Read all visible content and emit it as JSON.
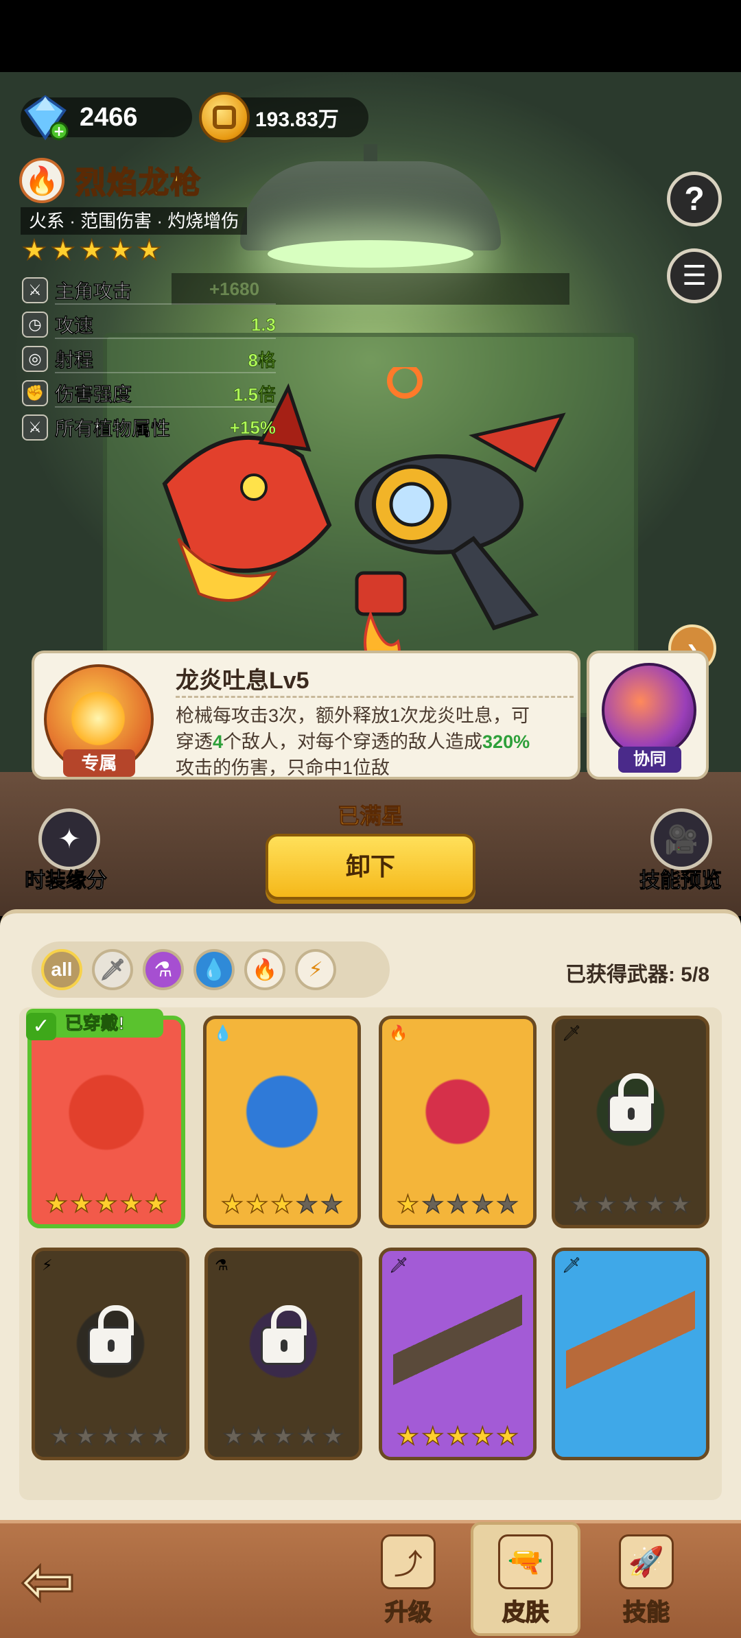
{
  "currency": {
    "gems": "2466",
    "gold": "193.83万"
  },
  "weapon": {
    "name": "烈焰龙枪",
    "tags": "火系 · 范围伤害 · 灼烧增伤",
    "stars": 5,
    "stats": [
      {
        "label": "主角攻击",
        "value": "+1680"
      },
      {
        "label": "攻速",
        "value": "1.3"
      },
      {
        "label": "射程",
        "value": "8格"
      },
      {
        "label": "伤害强度",
        "value": "1.5倍"
      },
      {
        "label": "所有植物属性",
        "value": "+15%"
      }
    ]
  },
  "skill": {
    "title": "龙炎吐息Lv5",
    "desc_parts": [
      "枪械每攻击3次，额外释放1次龙炎吐息，可穿透",
      "4",
      "个敌人，对每个穿透的敌人造成",
      "320%",
      "攻击的伤害，只命中1位敌"
    ],
    "exclusive_tag": "专属",
    "synergy_tag": "协同"
  },
  "status_text": "已满星",
  "unequip_label": "卸下",
  "side": {
    "costume": "时装缘分",
    "preview": "技能预览"
  },
  "filters": [
    "all",
    "sword",
    "poison",
    "water",
    "fire",
    "electric"
  ],
  "filter_all_label": "all",
  "collected_text": "已获得武器: 5/8",
  "equipped_tag": "已穿戴!",
  "cards": [
    {
      "bg": "#f25a4a",
      "element": "",
      "stars": 5,
      "locked": false,
      "equipped": true
    },
    {
      "bg": "#f4b53a",
      "element": "water",
      "stars": 3,
      "locked": false,
      "equipped": false
    },
    {
      "bg": "#f4b53a",
      "element": "fire",
      "stars": 1,
      "locked": false,
      "equipped": false
    },
    {
      "bg": "#4a3a22",
      "element": "sword",
      "stars": 0,
      "locked": true,
      "equipped": false
    },
    {
      "bg": "#4a3a22",
      "element": "electric",
      "stars": 0,
      "locked": true,
      "equipped": false
    },
    {
      "bg": "#4a3a22",
      "element": "poison",
      "stars": 0,
      "locked": true,
      "equipped": false
    },
    {
      "bg": "#a35bd6",
      "element": "sword",
      "stars": 5,
      "locked": false,
      "equipped": false
    },
    {
      "bg": "#3fa8e8",
      "element": "sword",
      "stars": 0,
      "locked": false,
      "equipped": false
    }
  ],
  "nav": {
    "upgrade": "升级",
    "skin": "皮肤",
    "skills": "技能",
    "active": "skin"
  },
  "colors": {
    "stat_value": "#b3ff5a",
    "gold_title": "#ffd449",
    "unequip": "#f5b81a"
  }
}
